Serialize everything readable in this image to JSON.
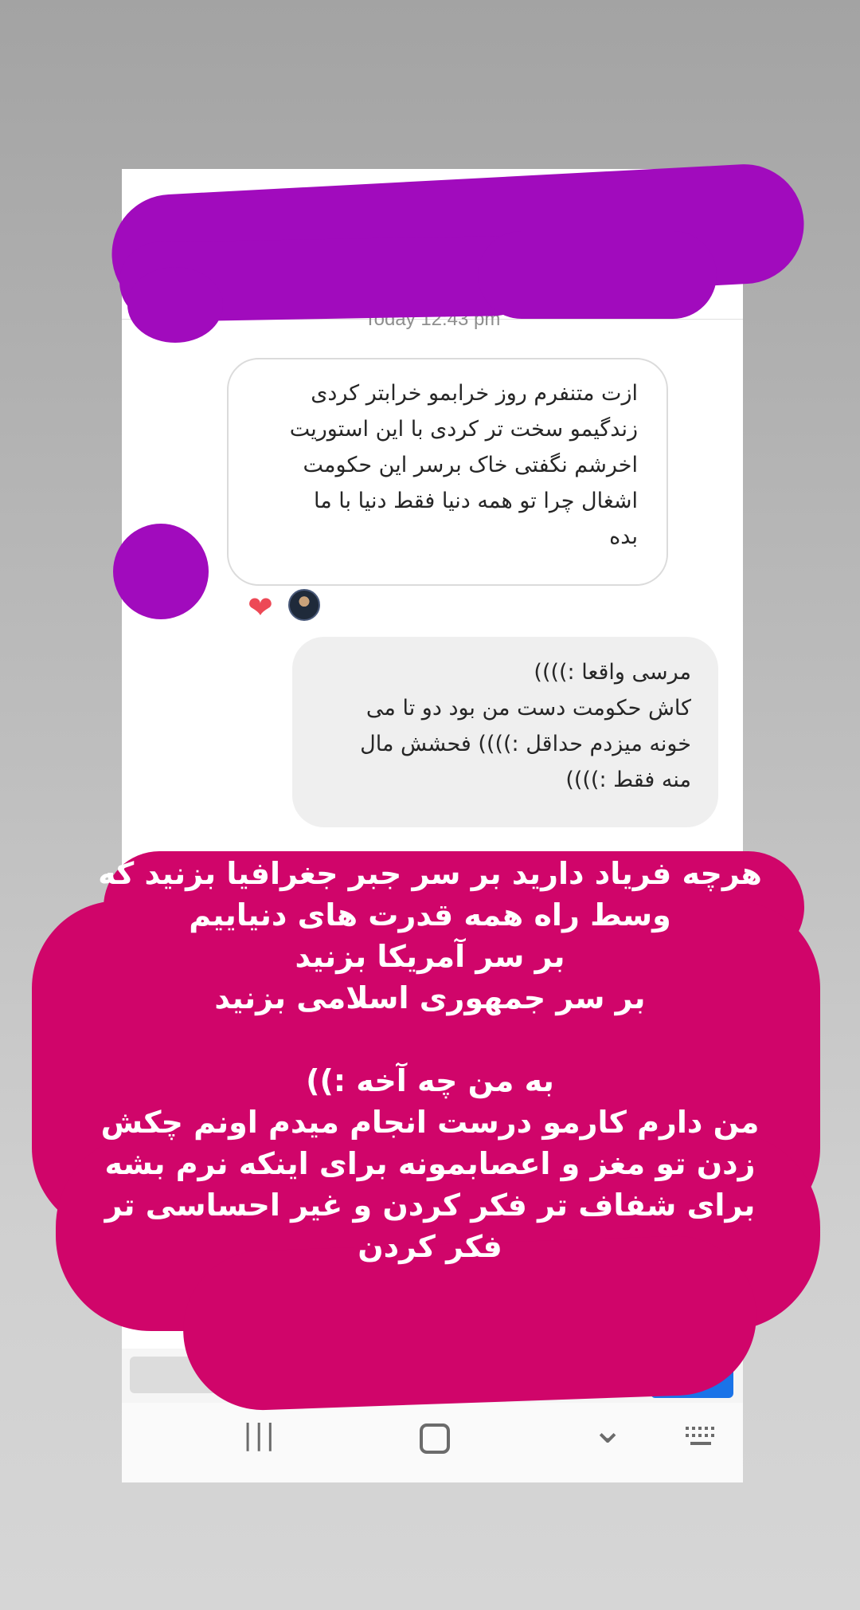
{
  "conversation": {
    "timestamp": "Today 12:43 pm",
    "messages": [
      {
        "direction": "incoming",
        "lines": [
          "ازت متنفرم روز خرابمو خرابتر کردی",
          "زندگیمو سخت تر کردی با این استوریت",
          "اخرشم نگفتی خاک برسر این حکومت",
          "اشغال چرا تو همه دنیا فقط دنیا با ما",
          "بده"
        ],
        "reactions": [
          "heart-icon",
          "user-avatar"
        ]
      },
      {
        "direction": "outgoing",
        "lines": [
          "مرسی واقعا :))))",
          "کاش حکومت دست من بود دو تا می",
          "خونه میزدم حداقل :)))) فحشش مال",
          "منه فقط :))))"
        ]
      }
    ]
  },
  "overlay": {
    "lines": [
      "هرچه فریاد دارید بر سر جبر جغرافیا بزنید که",
      "وسط راه همه قدرت های دنیاییم",
      "بر سر آمریکا بزنید",
      "بر سر جمهوری اسلامی بزنید",
      "",
      "به من چه آخه :))",
      "من دارم کارمو درست انجام میدم اونم چکش",
      "زدن تو مغز و اعصابمونه برای اینکه نرم بشه",
      "برای شفاف تر فکر کردن و غیر احساسی تر",
      "فکر کردن"
    ]
  },
  "colors": {
    "redaction_purple": "#a10bbd",
    "overlay_magenta": "#d0056a",
    "send_blue": "#1a73e8"
  },
  "navbar": {
    "icons": [
      "recent-apps-icon",
      "home-icon",
      "back-icon",
      "keyboard-icon"
    ],
    "recent_glyph": "|||",
    "back_glyph": "⌄"
  }
}
